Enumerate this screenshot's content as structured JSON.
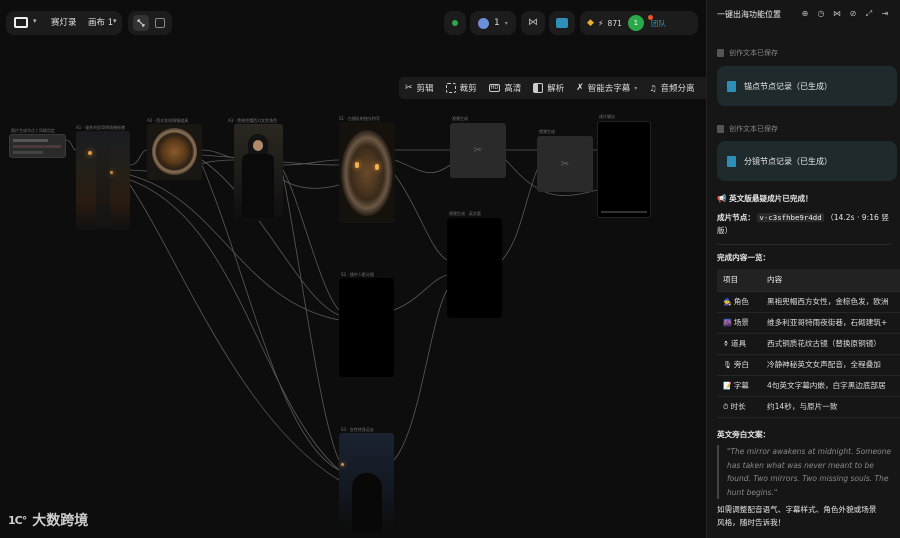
{
  "topbar": {
    "project_name": "赛灯录",
    "canvas_name": "画布 1",
    "avatar_count": "1",
    "credits": "871",
    "user_badge": "1",
    "team_label": "团队"
  },
  "toolbar": {
    "items": [
      "剪辑",
      "裁剪",
      "高清",
      "解析",
      "智能去字幕",
      "音频分离"
    ]
  },
  "canvas_nodes": {
    "n1": "图片生成节点 | 风格设定",
    "n2": "A1 · 维多利亚哥特雨夜街巷",
    "n3": "A2 · 西式花纹铜镜道具",
    "n4": "A3 · 黑袍兜帽西方女性角色",
    "n5": "S1 · 古镜反射烛光特写",
    "n6": "视频生成",
    "n7": "视频生成",
    "n8": "成片输出",
    "n9": "S2 · 镜中人影分镜",
    "n10": "S3 · 女性转身远去",
    "n11": "视频生成 · 英文版"
  },
  "panel": {
    "title": "一键出海功能位置",
    "saved_note_1": "创作文本已保存",
    "card_1": "锚点节点记录（已生成）",
    "saved_note_2": "创作文本已保存",
    "card_2": "分镜节点记录（已生成）",
    "done_title": "📢 英文版悬疑成片已完成！",
    "node_label": "成片节点：",
    "node_id": "v-c3sfhbe9r4dd",
    "node_meta_1": "（14.2s · 9:16 竖",
    "node_meta_2": "版）",
    "list_title": "完成内容一览：",
    "table_headers": [
      "项目",
      "内容"
    ],
    "table_rows": [
      {
        "icon": "🧙",
        "item": "角色",
        "content": "黑袍兜帽西方女性，金棕色发，欧洲"
      },
      {
        "icon": "🌆",
        "item": "场景",
        "content": "维多利亚哥特雨夜街巷，石砌建筑+"
      },
      {
        "icon": "⚱",
        "item": "道具",
        "content": "西式铜质花纹古镜（替换原铜镜）"
      },
      {
        "icon": "🎙",
        "item": "旁白",
        "content": "冷静神秘英文女声配音，全程叠加"
      },
      {
        "icon": "📝",
        "item": "字幕",
        "content": "4句英文字幕内嵌，白字黑边底部居"
      },
      {
        "icon": "⏱",
        "item": "时长",
        "content": "约14秒，与原片一致"
      }
    ],
    "narration_title": "英文旁白文案：",
    "narration_lines": [
      "\"The mirror awakens at midnight. Someone",
      "has taken what was never meant to be",
      "found. Two mirrors. Two missing souls. The",
      "hunt begins.\""
    ],
    "footer_1": "如需调整配音语气、字幕样式、角色外貌或场景",
    "footer_2": "风格，随时告诉我！"
  },
  "watermark": "大数跨境",
  "colors": {
    "accent": "#2e8fb8",
    "green": "#2aa84a",
    "bg": "#0d0d0d",
    "panel": "#161616"
  }
}
